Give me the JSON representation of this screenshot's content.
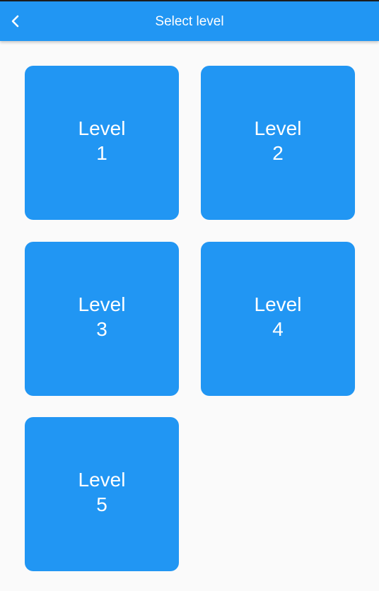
{
  "appbar": {
    "title": "Select level",
    "back_icon": "chevron-left-icon",
    "color": "#2196f3"
  },
  "levels": [
    {
      "word": "Level",
      "number": "1"
    },
    {
      "word": "Level",
      "number": "2"
    },
    {
      "word": "Level",
      "number": "3"
    },
    {
      "word": "Level",
      "number": "4"
    },
    {
      "word": "Level",
      "number": "5"
    }
  ],
  "colors": {
    "accent": "#2196f3",
    "background": "#fafafa",
    "text_on_accent": "#ffffff"
  }
}
